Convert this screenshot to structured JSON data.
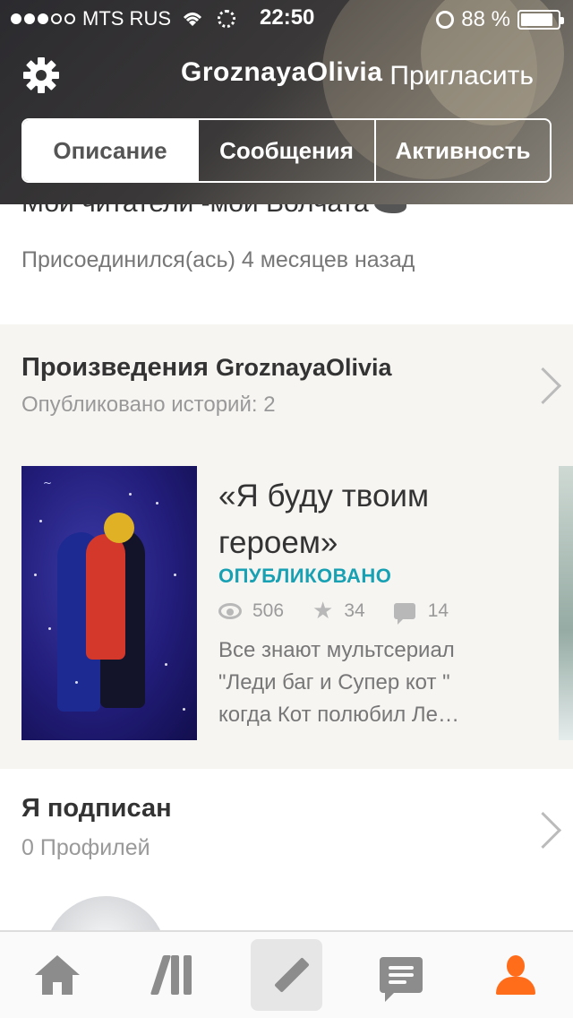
{
  "status_bar": {
    "carrier": "MTS RUS",
    "time": "22:50",
    "battery": "88 %",
    "signal_filled": 3,
    "signal_total": 5,
    "battery_level": 0.88
  },
  "nav": {
    "title": "GroznayaOlivia",
    "invite_label": "Пригласить",
    "settings_icon": "gear-icon"
  },
  "tabs": [
    {
      "label": "Описание",
      "active": true
    },
    {
      "label": "Сообщения",
      "active": false
    },
    {
      "label": "Активность",
      "active": false
    }
  ],
  "about": {
    "text": "Мои читатели -мои Волчата",
    "joined": "Присоединился(ась) 4 месяцев назад"
  },
  "works": {
    "title_prefix": "Произведения",
    "title_user": "GroznayaOlivia",
    "subtitle": "Опубликовано историй: 2",
    "story": {
      "title": "«Я буду твоим героем»",
      "status": "ОПУБЛИКОВАНО",
      "views": "506",
      "votes": "34",
      "comments": "14",
      "description": "Все знают мультсериал \"Леди баг и Супер кот \" когда Кот полюбил Ле…"
    }
  },
  "following": {
    "title": "Я подписан",
    "subtitle": "0 Профилей"
  },
  "bottom_tabs": [
    {
      "icon": "home-icon"
    },
    {
      "icon": "library-icon"
    },
    {
      "icon": "pencil-icon"
    },
    {
      "icon": "chat-icon"
    },
    {
      "icon": "user-icon"
    }
  ],
  "colors": {
    "accent": "#ff6c1a",
    "status_teal": "#18a0b3"
  }
}
